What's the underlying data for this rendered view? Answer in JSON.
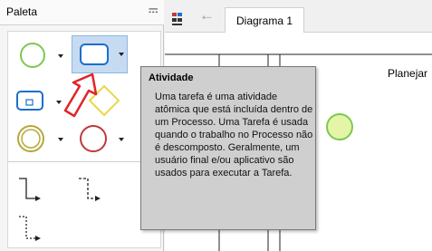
{
  "palette": {
    "title": "Paleta",
    "pin_icon": "pin-icon",
    "tools": [
      {
        "name": "start-event-tool",
        "icon": "circle-green-icon"
      },
      {
        "name": "task-tool",
        "icon": "rounded-rect-icon",
        "selected": true
      },
      {
        "name": "subprocess-tool",
        "icon": "subprocess-icon"
      },
      {
        "name": "gateway-tool",
        "icon": "diamond-icon"
      },
      {
        "name": "intermediate-event-tool",
        "icon": "circle-double-icon"
      },
      {
        "name": "end-event-tool",
        "icon": "circle-red-icon"
      },
      {
        "name": "sequence-flow-tool",
        "icon": "sequence-flow-icon"
      },
      {
        "name": "message-flow-tool",
        "icon": "message-flow-icon"
      },
      {
        "name": "association-tool",
        "icon": "association-icon"
      }
    ]
  },
  "editor": {
    "tab_label": "Diagrama 1",
    "lane_label": "Planejar"
  },
  "tooltip": {
    "title": "Atividade",
    "body": "Uma tarefa é uma atividade atômica que está incluída dentro de um Processo. Uma Tarefa é usada quando o trabalho no Processo não é descomposto. Geralmente, um usuário final e/ou aplicativo são usados para executar a Tarefa."
  },
  "colors": {
    "accent_blue": "#1a6fcf",
    "start_green": "#7ec850",
    "end_red": "#c0393b",
    "intermediate_olive": "#b5a93a",
    "gateway_yellow": "#e8d84a",
    "pointer_red": "#e0242a"
  }
}
